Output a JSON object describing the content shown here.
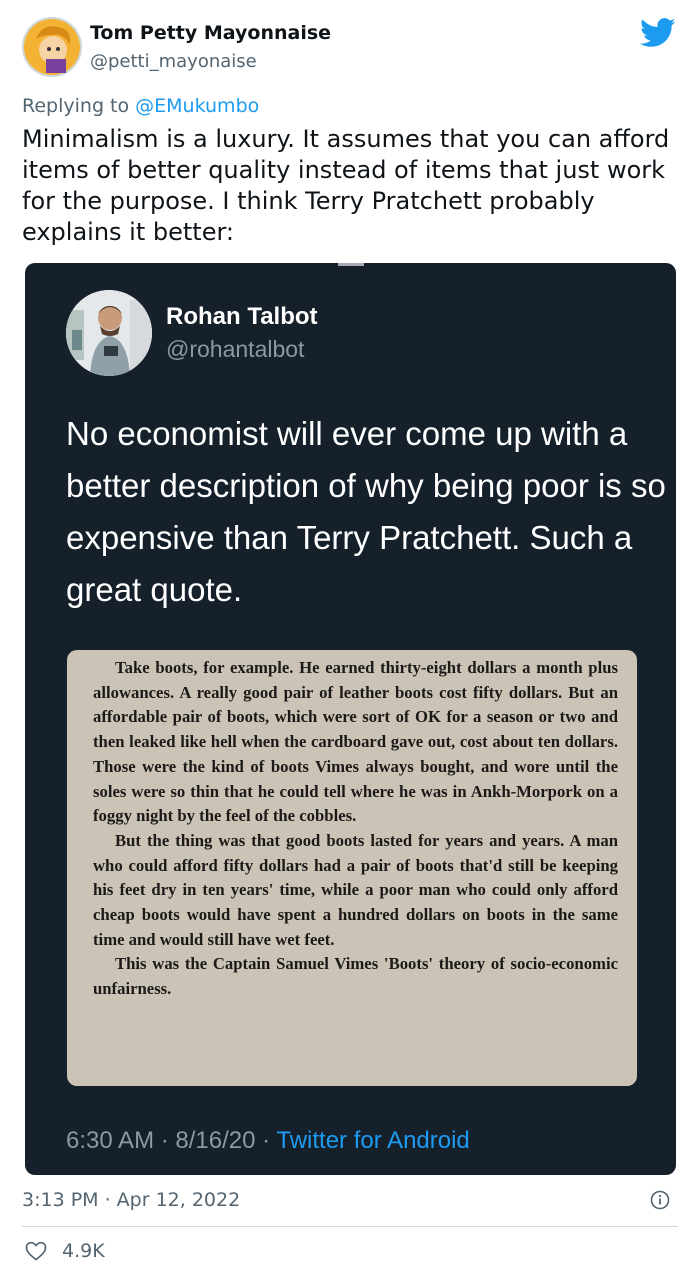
{
  "tweet": {
    "author_name": "Tom Petty Mayonnaise",
    "author_handle": "@petti_mayonaise",
    "replying_prefix": "Replying to ",
    "replying_to": "@EMukumbo",
    "text": "Minimalism is a luxury. It assumes that you can afford items of better quality instead of items that just work for the purpose. I think Terry Pratchett probably explains it better:",
    "timestamp": "3:13 PM · Apr 12, 2022",
    "likes": "4.9K"
  },
  "embedded": {
    "author_name": "Rohan Talbot",
    "author_handle": "@rohantalbot",
    "text": "No economist will ever come up with a better description of why being poor is so expensive than Terry Pratchett. Such a great quote.",
    "time": "6:30 AM · 8/16/20 · ",
    "source": "Twitter for Android",
    "book_page": {
      "p1": "Take boots, for example. He earned thirty-eight dollars a month plus allowances. A really good pair of leather boots cost fifty dollars. But an affordable pair of boots, which were sort of OK for a season or two and then leaked like hell when the cardboard gave out, cost about ten dollars. Those were the kind of boots Vimes always bought, and wore until the soles were so thin that he could tell where he was in Ankh-Morpork on a foggy night by the feel of the cobbles.",
      "p2": "But the thing was that good boots lasted for years and years. A man who could afford fifty dollars had a pair of boots that'd still be keeping his feet dry in ten years' time, while a poor man who could only afford cheap boots would have spent a hundred dollars on boots in the same time and would still have wet feet.",
      "p3": "This was the Captain Samuel Vimes 'Boots' theory of socio-economic unfairness."
    }
  },
  "icons": {
    "brand": "twitter-bird-icon",
    "info": "info-icon",
    "like": "heart-icon"
  },
  "colors": {
    "accent": "#1d9bf0",
    "card_bg": "#15202b",
    "secondary_text": "#536471"
  }
}
